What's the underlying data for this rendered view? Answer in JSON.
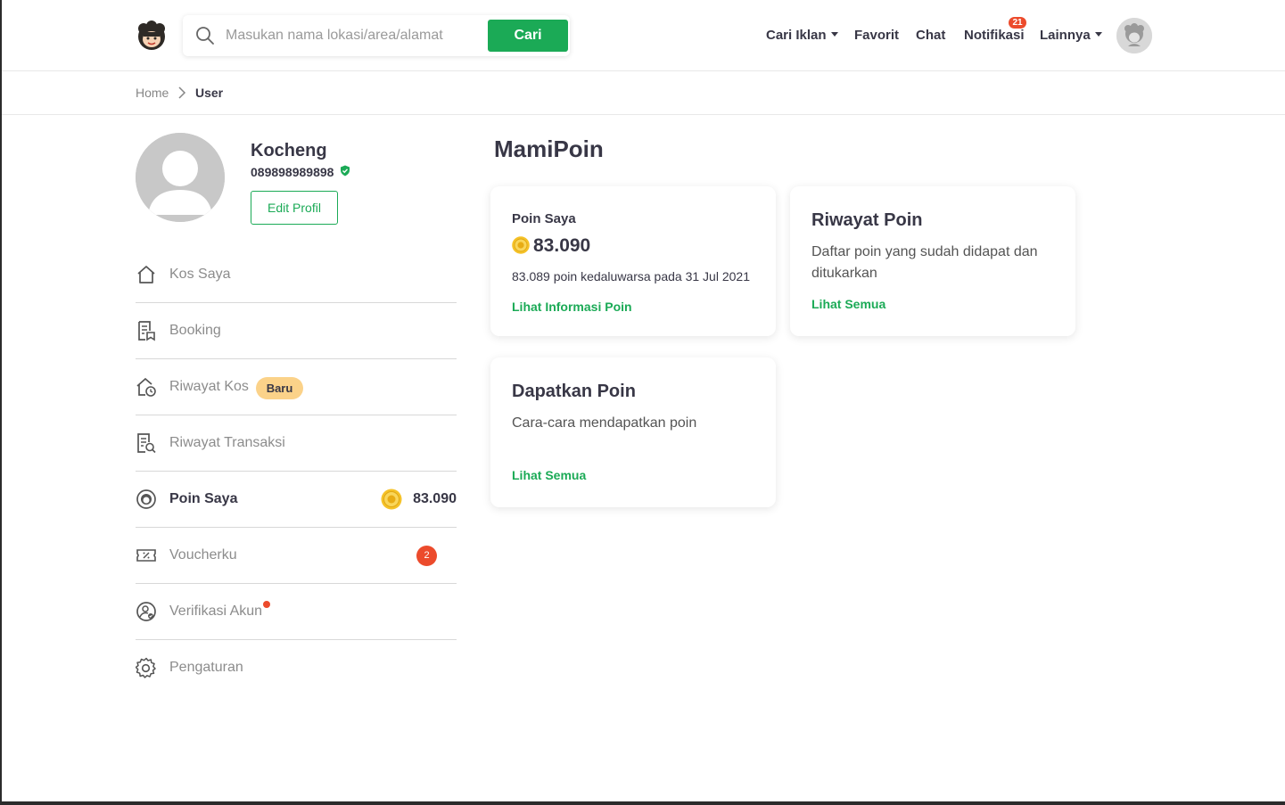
{
  "header": {
    "search_placeholder": "Masukan nama lokasi/area/alamat",
    "search_button": "Cari",
    "nav": {
      "cari_iklan": "Cari Iklan",
      "favorit": "Favorit",
      "chat": "Chat",
      "notifikasi": "Notifikasi",
      "notifikasi_count": "21",
      "lainnya": "Lainnya"
    }
  },
  "breadcrumb": {
    "home": "Home",
    "current": "User"
  },
  "profile": {
    "name": "Kocheng",
    "phone": "089898989898",
    "edit_button": "Edit Profil"
  },
  "menu": {
    "kos_saya": "Kos Saya",
    "booking": "Booking",
    "riwayat_kos": "Riwayat Kos",
    "riwayat_kos_badge": "Baru",
    "riwayat_transaksi": "Riwayat Transaksi",
    "poin_saya": "Poin Saya",
    "poin_saya_value": "83.090",
    "voucherku": "Voucherku",
    "voucherku_count": "2",
    "verifikasi_akun": "Verifikasi Akun",
    "pengaturan": "Pengaturan"
  },
  "main": {
    "title": "MamiPoin",
    "points_card": {
      "label": "Poin Saya",
      "value": "83.090",
      "expiry": "83.089 poin kedaluwarsa pada 31 Jul 2021",
      "link": "Lihat Informasi Poin"
    },
    "history_card": {
      "title": "Riwayat Poin",
      "description": "Daftar poin yang sudah didapat dan ditukarkan",
      "link": "Lihat Semua"
    },
    "earn_card": {
      "title": "Dapatkan Poin",
      "description": "Cara-cara mendapatkan poin",
      "link": "Lihat Semua"
    }
  },
  "colors": {
    "brand_green": "#1baa56",
    "badge_red": "#ec4b2c",
    "baru_yellow": "#fbd289",
    "coin_gold": "#f5c228"
  }
}
